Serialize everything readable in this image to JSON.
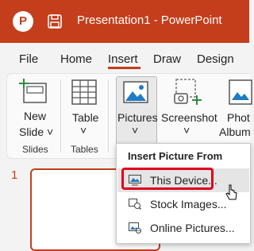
{
  "titlebar": {
    "app_letter": "P",
    "title": "Presentation1  -  PowerPoint",
    "accent_color": "#c43e1c"
  },
  "tabs": [
    {
      "label": "File"
    },
    {
      "label": "Home"
    },
    {
      "label": "Insert",
      "active": true
    },
    {
      "label": "Draw"
    },
    {
      "label": "Design"
    }
  ],
  "ribbon": {
    "new_slide": {
      "line1": "New",
      "line2": "Slide ˅",
      "icon": "new-slide-icon"
    },
    "group_slides": "Slides",
    "table": {
      "label": "Table",
      "arrow": "˅",
      "icon": "table-icon"
    },
    "group_tables": "Tables",
    "pictures": {
      "label": "Pictures",
      "arrow": "˅",
      "icon": "pictures-icon"
    },
    "screenshot": {
      "label": "Screenshot",
      "arrow": "˅",
      "icon": "screenshot-icon"
    },
    "photo_album": {
      "line1": "Phot",
      "line2": "Album",
      "icon": "photo-album-icon"
    }
  },
  "slide_panel": {
    "slide_number": "1"
  },
  "menu": {
    "header": "Insert Picture From",
    "items": [
      {
        "label": "This Device...",
        "icon": "this-device-icon",
        "highlighted": true
      },
      {
        "label": "Stock Images...",
        "icon": "stock-images-icon"
      },
      {
        "label": "Online Pictures...",
        "icon": "online-pictures-icon"
      }
    ]
  }
}
